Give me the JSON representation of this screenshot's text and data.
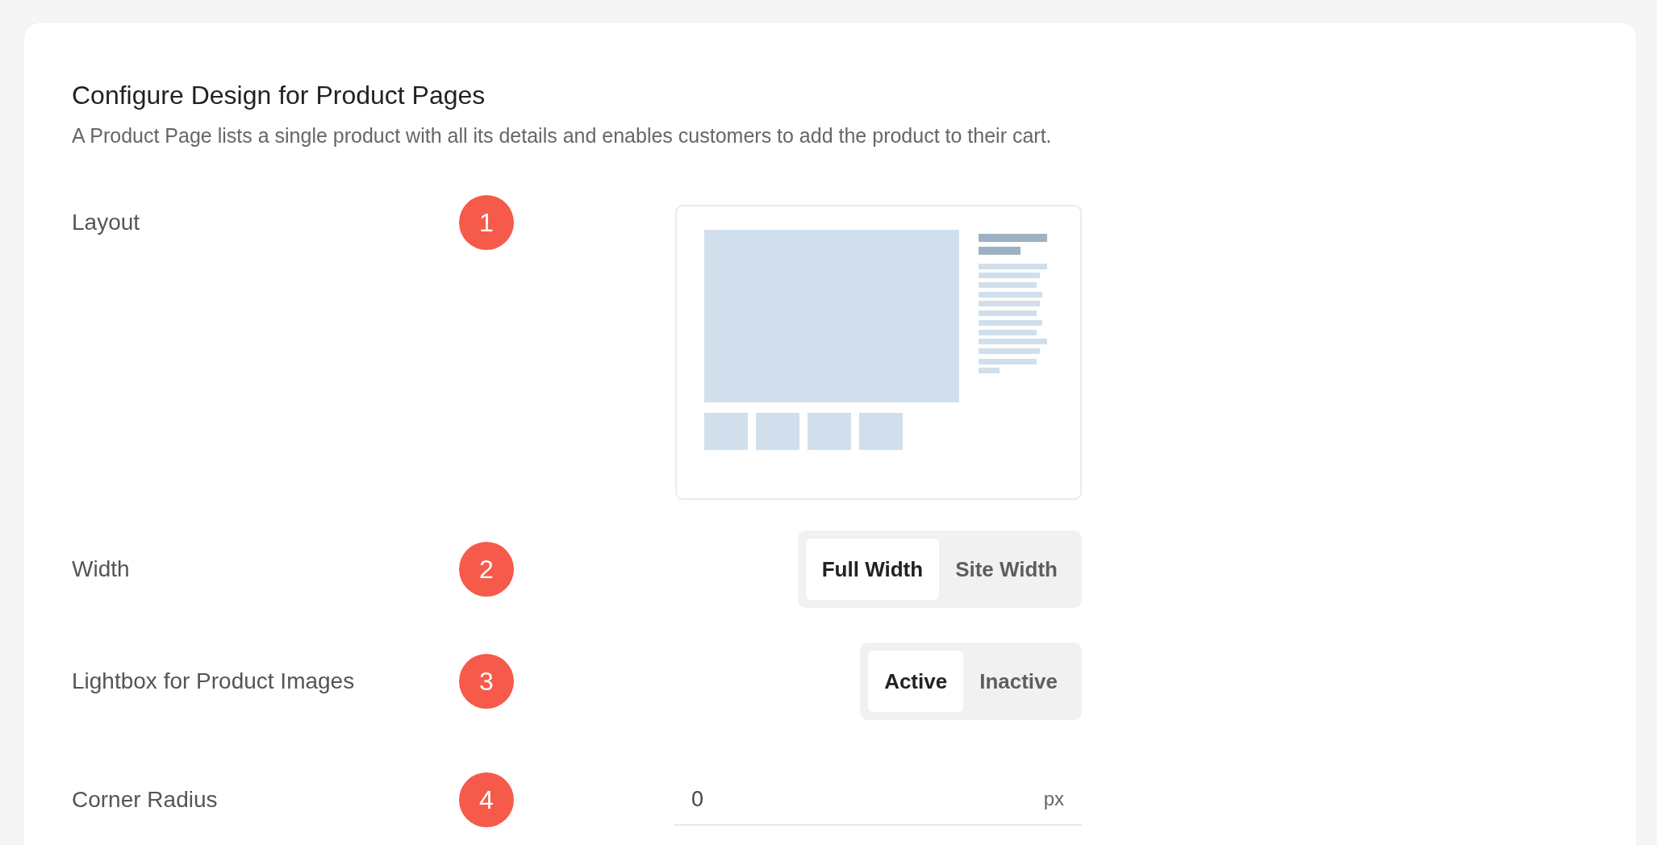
{
  "title": "Configure Design for Product Pages",
  "description": "A Product Page lists a single product with all its details and enables customers to add the product to their cart.",
  "settings": [
    {
      "kind": "layout",
      "label": "Layout",
      "badge": "1"
    },
    {
      "kind": "segmented",
      "label": "Width",
      "badge": "2",
      "options": [
        {
          "label": "Full Width",
          "selected": true
        },
        {
          "label": "Site Width",
          "selected": false
        }
      ]
    },
    {
      "kind": "segmented",
      "label": "Lightbox for Product Images",
      "badge": "3",
      "options": [
        {
          "label": "Active",
          "selected": true
        },
        {
          "label": "Inactive",
          "selected": false
        }
      ]
    },
    {
      "kind": "number",
      "label": "Corner Radius",
      "badge": "4",
      "value": "0",
      "unit": "px"
    }
  ]
}
